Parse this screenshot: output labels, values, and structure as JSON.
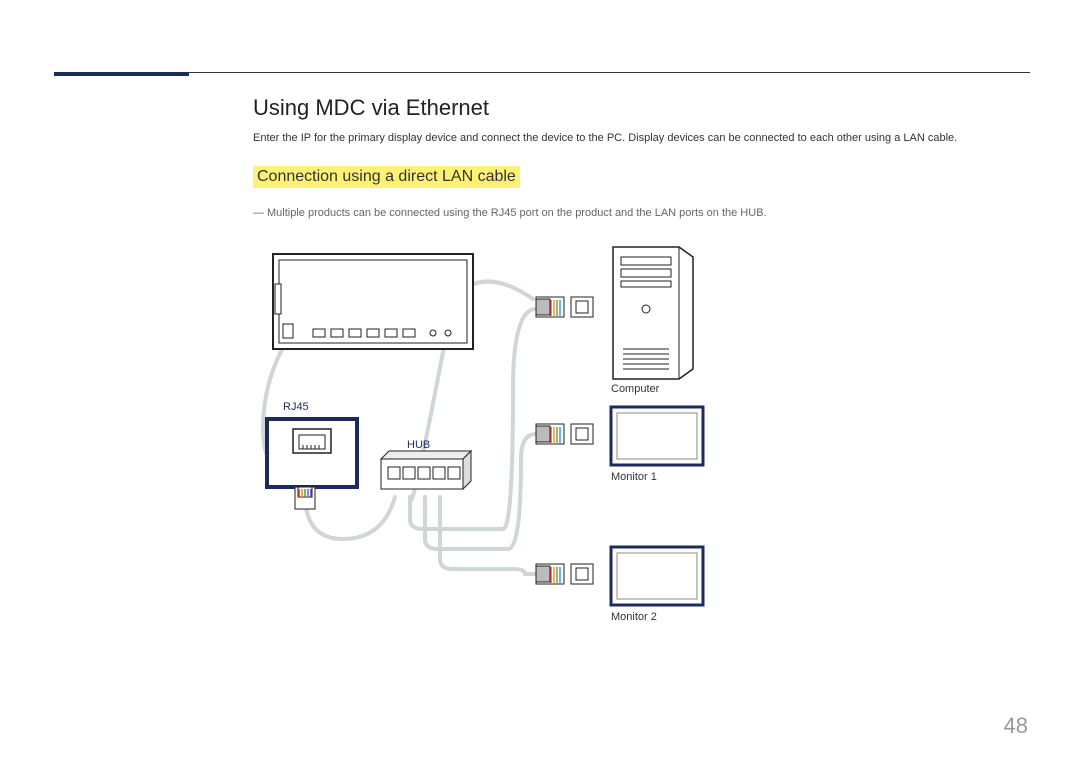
{
  "page": {
    "title": "Using MDC via Ethernet",
    "intro": "Enter the IP for the primary display device and connect the device to the PC. Display devices can be connected to each other using a LAN cable.",
    "subTitle": "Connection using a direct LAN cable",
    "note": "Multiple products can be connected using the RJ45 port on the product and the LAN ports on the HUB.",
    "pageNumber": "48"
  },
  "diagram": {
    "labels": {
      "rj45": "RJ45",
      "hub": "HUB",
      "computer": "Computer",
      "monitor1": "Monitor 1",
      "monitor2": "Monitor 2"
    }
  }
}
